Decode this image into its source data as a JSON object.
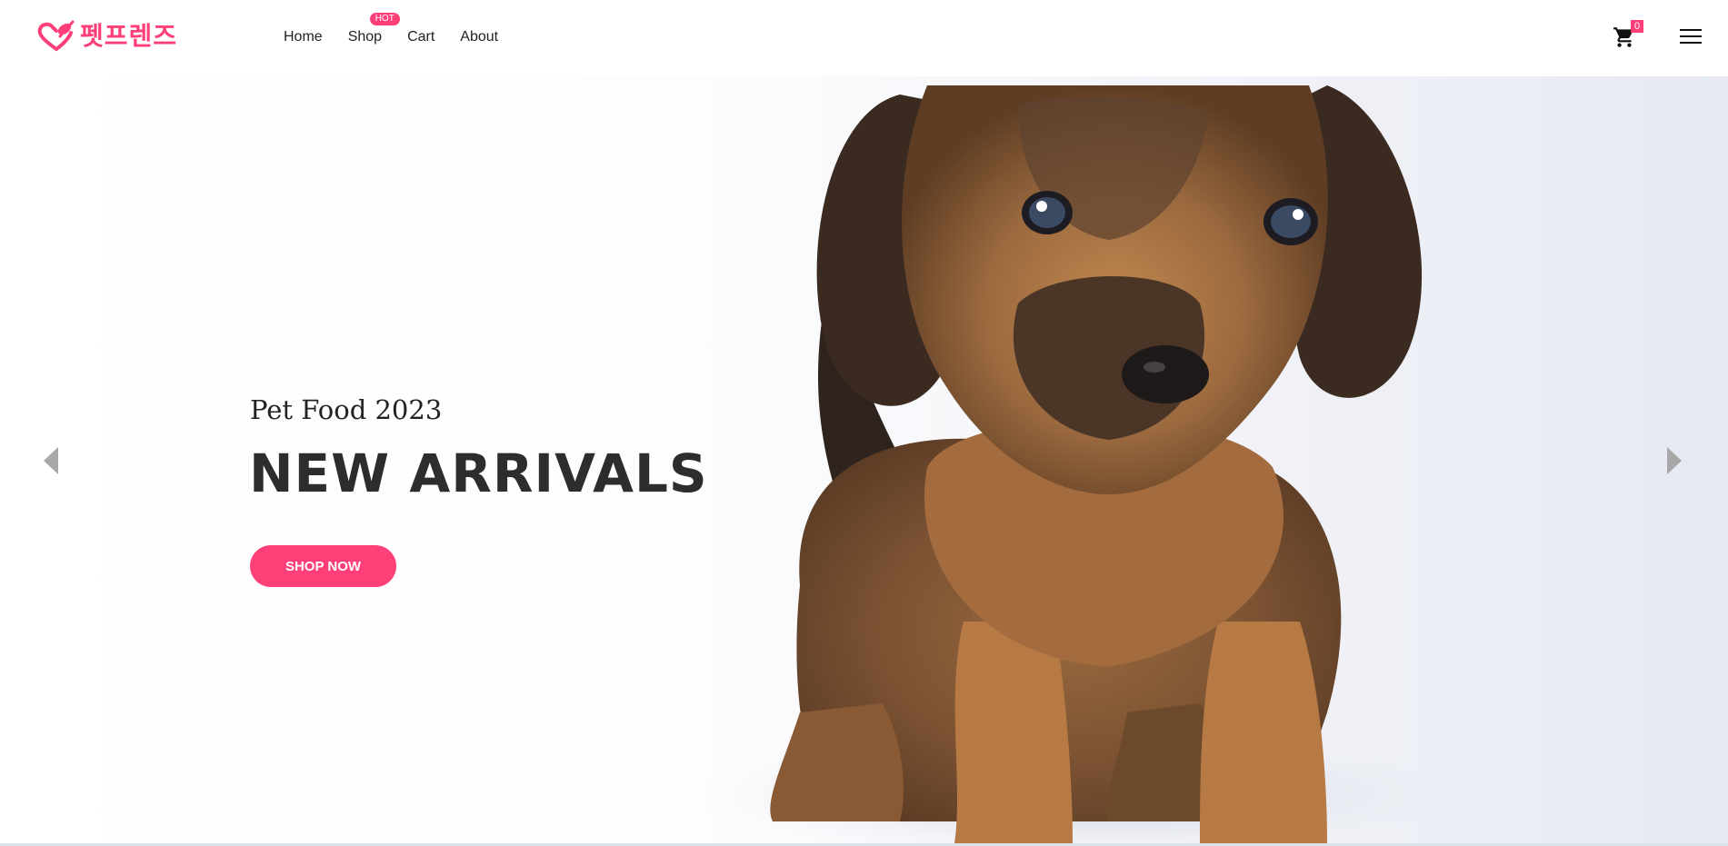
{
  "brand": {
    "logo_text": "펫프렌즈",
    "accent_color": "#ff3f78",
    "logo_icon": "heart-paw-icon"
  },
  "nav": {
    "items": [
      {
        "label": "Home"
      },
      {
        "label": "Shop",
        "badge": "HOT"
      },
      {
        "label": "Cart"
      },
      {
        "label": "About"
      }
    ]
  },
  "header": {
    "cart_icon": "cart-icon",
    "cart_count": "0",
    "menu_icon": "hamburger-menu-icon"
  },
  "hero": {
    "subtitle": "Pet Food 2023",
    "title": "NEW ARRIVALS",
    "cta_label": "SHOP NOW",
    "prev_icon": "chevron-left-icon",
    "next_icon": "chevron-right-icon",
    "image": "puppy-image"
  }
}
